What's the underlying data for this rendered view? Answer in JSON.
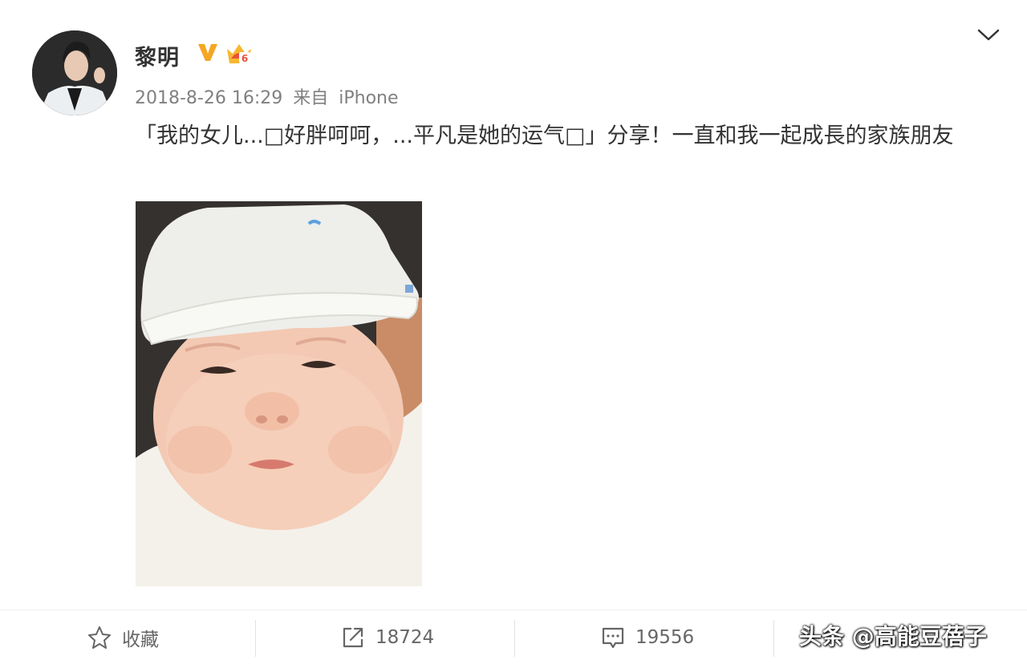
{
  "post": {
    "username": "黎明",
    "verified_badge": "V",
    "timestamp": "2018-8-26 16:29",
    "source_prefix": "来自",
    "source_device": "iPhone",
    "text": "「我的女儿...□好胖呵呵，...平凡是她的运气□」分享！一直和我一起成長的家族朋友"
  },
  "icons": {
    "avatar": "user-avatar",
    "verified": "verified-v-icon",
    "member": "crown-member-icon",
    "dropdown": "chevron-down-icon",
    "favorite": "star-icon",
    "repost": "share-arrow-icon",
    "comment": "comment-icon"
  },
  "actions": {
    "favorite_label": "收藏",
    "repost_count": "18724",
    "comment_count": "19556"
  },
  "watermark": "头条 @高能豆蓓子",
  "colors": {
    "verified": "#f5a623",
    "crown": "#f7b731",
    "text": "#333333",
    "meta": "#808080"
  }
}
